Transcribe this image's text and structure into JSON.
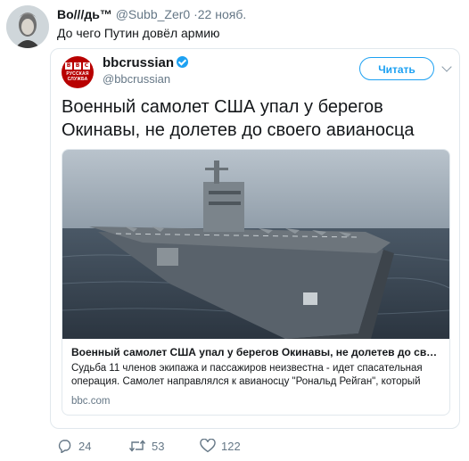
{
  "tweet": {
    "author_name": "Во///дь™",
    "handle": "@Subb_Zer0",
    "time": "·22 нояб.",
    "text": "До чего Путин довёл армию"
  },
  "quoted": {
    "source_name": "bbcrussian",
    "source_handle": "@bbcrussian",
    "follow_label": "Читать",
    "logo_text": {
      "letters": [
        "B",
        "B",
        "C"
      ],
      "service_line1": "РУССКАЯ",
      "service_line2": "СЛУЖБА"
    },
    "headline": "Военный самолет США упал у берегов Окинавы, не долетев до своего авианосца",
    "card": {
      "title": "Военный самолет США упал у берегов Окинавы, не долетев до своего ав...",
      "description": "Судьба 11 членов экипажа и пассажиров неизвестна - идет спасательная операция. Самолет направлялся к авианосцу \"Рональд Рейган\", который",
      "domain": "bbc.com"
    }
  },
  "actions": {
    "replies": "24",
    "retweets": "53",
    "likes": "122"
  },
  "colors": {
    "accent": "#1da1f2",
    "bbc_red": "#b80000",
    "muted": "#657786"
  },
  "icons": [
    "reply-icon",
    "retweet-icon",
    "like-icon",
    "verified-icon",
    "chevron-down-icon"
  ]
}
